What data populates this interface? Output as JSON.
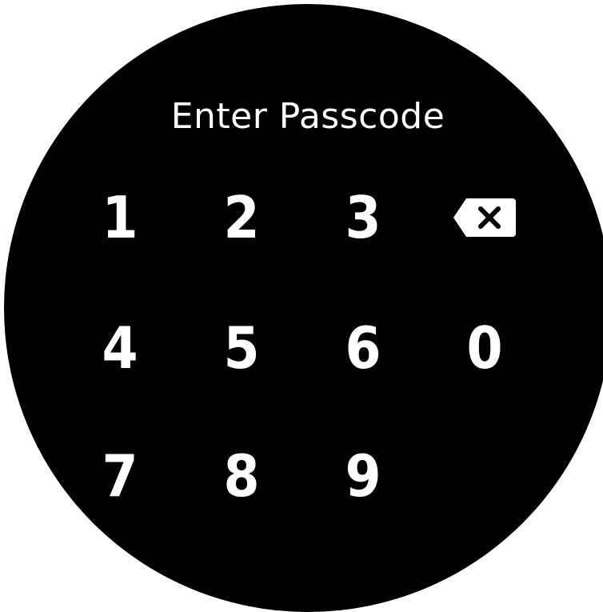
{
  "title": "Enter Passcode",
  "keys": {
    "k1": "1",
    "k2": "2",
    "k3": "3",
    "k4": "4",
    "k5": "5",
    "k6": "6",
    "k0": "0",
    "k7": "7",
    "k8": "8",
    "k9": "9"
  },
  "icons": {
    "backspace": "backspace-icon"
  },
  "colors": {
    "background": "#000000",
    "text": "#ffffff",
    "outer": "#ffffff"
  }
}
